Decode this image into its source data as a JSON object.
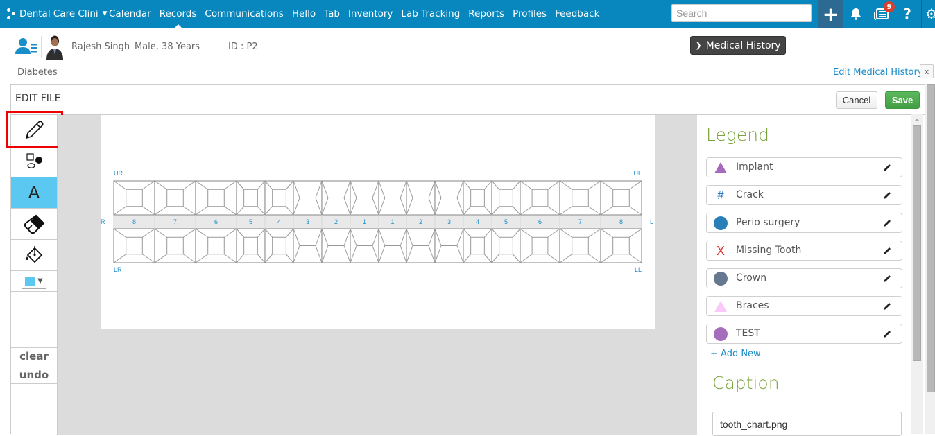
{
  "topbar": {
    "brand": "Dental Care Clini",
    "nav": [
      "Calendar",
      "Records",
      "Communications",
      "Hello",
      "Tab",
      "Inventory",
      "Lab Tracking",
      "Reports",
      "Profiles",
      "Feedback"
    ],
    "active_nav": "Records",
    "search_placeholder": "Search",
    "notification_count": "9",
    "help_label": "?"
  },
  "patient": {
    "name": "Rajesh Singh",
    "meta": "Male, 38 Years",
    "id": "ID : P2",
    "condition": "Diabetes",
    "medical_history_button": "Medical History",
    "edit_medical_history": "Edit Medical History",
    "close_label": "x"
  },
  "edit_file": {
    "title": "EDIT FILE",
    "cancel": "Cancel",
    "save": "Save"
  },
  "tools": {
    "items": [
      "pencil",
      "shapes",
      "text",
      "eraser",
      "fill"
    ],
    "active": "text",
    "selected_highlight": "pencil",
    "text_glyph": "A",
    "color_value": "#5bc8f2",
    "clear": "clear",
    "undo": "undo"
  },
  "tooth_chart": {
    "quadrant_labels": {
      "upper_right": "UR",
      "upper_left": "UL",
      "lower_right": "LR",
      "lower_left": "LL"
    },
    "side_labels": {
      "right": "R",
      "left": "L"
    },
    "numbers": [
      "8",
      "7",
      "6",
      "5",
      "4",
      "3",
      "2",
      "1",
      "1",
      "2",
      "3",
      "4",
      "5",
      "6",
      "7",
      "8"
    ],
    "types": [
      "molar",
      "molar",
      "molar",
      "premolar",
      "premolar",
      "anterior",
      "anterior",
      "anterior",
      "anterior",
      "anterior",
      "anterior",
      "premolar",
      "premolar",
      "molar",
      "molar",
      "molar"
    ]
  },
  "legend": {
    "title": "Legend",
    "items": [
      {
        "label": "Implant",
        "icon": "triangle",
        "color": "#a569bd"
      },
      {
        "label": "Crack",
        "icon": "hash",
        "color": "#1a73c8"
      },
      {
        "label": "Perio surgery",
        "icon": "circle",
        "color": "#2980b9"
      },
      {
        "label": "Missing Tooth",
        "icon": "x-mark",
        "color": "#e03030"
      },
      {
        "label": "Crown",
        "icon": "circle",
        "color": "#65788f"
      },
      {
        "label": "Braces",
        "icon": "triangle",
        "color": "#f9c9f9"
      },
      {
        "label": "TEST",
        "icon": "circle",
        "color": "#a56ebd"
      }
    ],
    "add_new": "+ Add New"
  },
  "caption": {
    "title": "Caption",
    "value": "tooth_chart.png"
  }
}
